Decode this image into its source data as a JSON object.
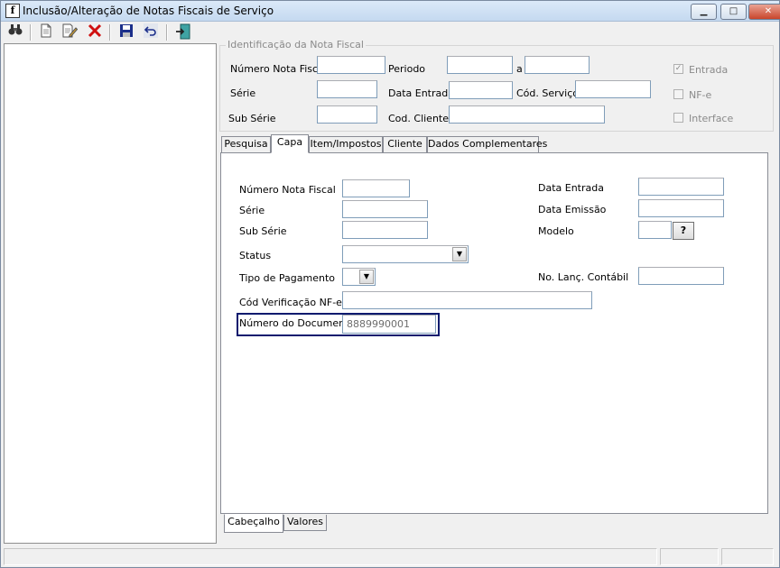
{
  "window": {
    "title": "Inclusão/Alteração de Notas Fiscais de Serviço",
    "app_icon": "f",
    "controls": {
      "minimize": "▭",
      "maximize": "▢",
      "close": "✕"
    }
  },
  "toolbar": {
    "icons": [
      "binoculars-icon",
      "new-document-icon",
      "edit-document-icon",
      "delete-icon",
      "save-icon",
      "undo-icon",
      "exit-icon"
    ]
  },
  "ident": {
    "legend": "Identificação da Nota Fiscal",
    "numero_label": "Número Nota Fiscal",
    "periodo_label": "Periodo",
    "periodo_a": "a",
    "serie_label": "Série",
    "data_entrada_label": "Data Entrada",
    "cod_servico_label": "Cód. Serviço",
    "sub_serie_label": "Sub Série",
    "cod_cliente_label": "Cod. Cliente",
    "entrada_label": "Entrada",
    "entrada_checked": true,
    "nfe_label": "NF-e",
    "interface_label": "Interface"
  },
  "tabs": [
    "Pesquisa",
    "Capa",
    "Item/Impostos",
    "Cliente",
    "Dados Complementares"
  ],
  "active_tab": "Capa",
  "capa": {
    "numero_label": "Número Nota Fiscal",
    "serie_label": "Série",
    "sub_serie_label": "Sub Série",
    "status_label": "Status",
    "status_value": "",
    "tipo_pagamento_label": "Tipo de Pagamento",
    "cod_verificacao_label": "Cód Verificação NF-e",
    "numero_documento_label": "Número do Documento",
    "numero_documento_value": "8889990001",
    "data_entrada_label": "Data Entrada",
    "data_emissao_label": "Data Emissão",
    "modelo_label": "Modelo",
    "help_label": "?",
    "lanc_contabil_label": "No. Lanç. Contábil"
  },
  "bottom_tabs": [
    "Cabeçalho",
    "Valores"
  ],
  "active_bottom_tab": "Cabeçalho"
}
